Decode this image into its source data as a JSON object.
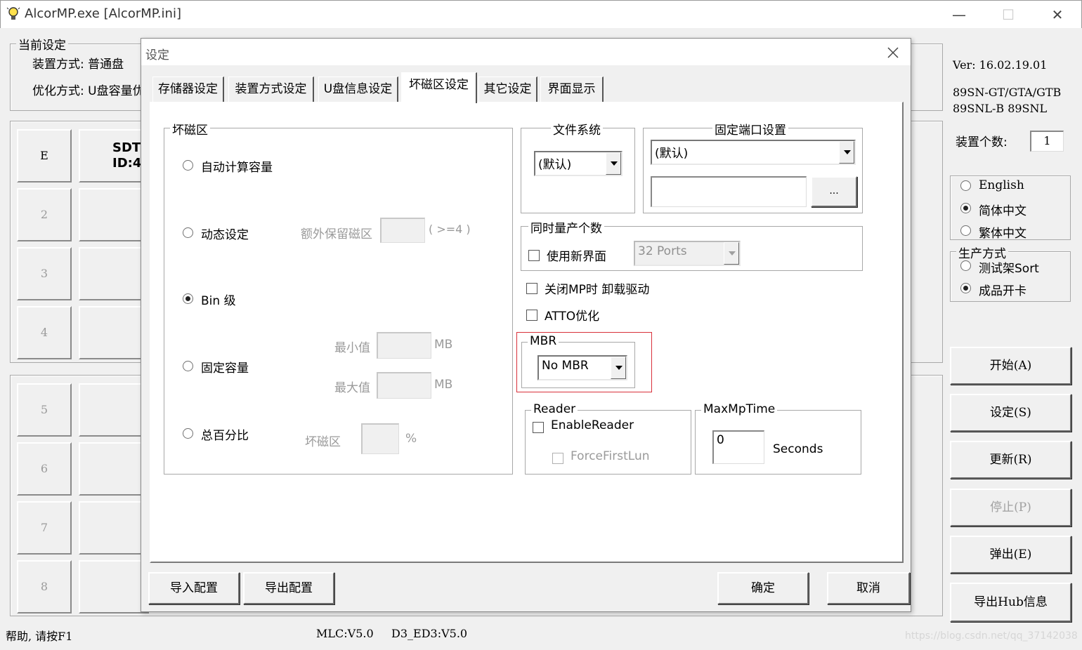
{
  "window": {
    "title": "AlcorMP.exe [AlcorMP.ini]",
    "controls": [
      "—",
      "☐",
      "✕"
    ]
  },
  "current_settings": {
    "group_label": "当前设定",
    "mount_mode": "装置方式: 普通盘",
    "optimize_mode": "优化方式: U盘容量优"
  },
  "slots": {
    "first_label": "E",
    "first_info_line1": "SDT",
    "first_info_line2": "ID:4",
    "numbers": [
      "2",
      "3",
      "4",
      "5",
      "6",
      "7",
      "8"
    ]
  },
  "right_panel": {
    "version": "Ver: 16.02.19.01",
    "models_line1": "89SN-GT/GTA/GTB",
    "models_line2": "89SNL-B 89SNL",
    "device_count_label": "装置个数:",
    "device_count_value": "1",
    "languages": [
      {
        "label": "English",
        "selected": false
      },
      {
        "label": "简体中文",
        "selected": true
      },
      {
        "label": "繁体中文",
        "selected": false
      }
    ],
    "production_mode": {
      "label": "生产方式",
      "options": [
        {
          "label": "测试架Sort",
          "selected": false
        },
        {
          "label": "成品开卡",
          "selected": true
        }
      ]
    },
    "buttons": {
      "start": "开始(A)",
      "settings": "设定(S)",
      "update": "更新(R)",
      "stop": "停止(P)",
      "eject": "弹出(E)",
      "export_hub": "导出Hub信息"
    }
  },
  "status_bar": {
    "help": "帮助, 请按F1",
    "mlc": "MLC:V5.0",
    "d3": "D3_ED3:V5.0",
    "watermark": "https://blog.csdn.net/qq_37142038"
  },
  "dialog": {
    "title": "设定",
    "tabs": [
      "存储器设定",
      "装置方式设定",
      "U盘信息设定",
      "坏磁区设定",
      "其它设定",
      "界面显示"
    ],
    "active_tab": "坏磁区设定",
    "bad_block": {
      "group_label": "坏磁区",
      "options": {
        "auto": "自动计算容量",
        "dynamic": "动态设定",
        "bin": "Bin 级",
        "fixed": "固定容量",
        "percent": "总百分比"
      },
      "selected": "Bin 级",
      "extra_reserve_label": "额外保留磁区",
      "extra_reserve_hint": "( >=4 )",
      "min_label": "最小值",
      "max_label": "最大值",
      "mb_unit": "MB",
      "badblock_label": "坏磁区",
      "percent_unit": "%"
    },
    "filesystem": {
      "label": "文件系统",
      "value": "(默认)"
    },
    "fixed_port": {
      "label": "固定端口设置",
      "value": "(默认)",
      "browse": "..."
    },
    "simultaneous": {
      "label": "同时量产个数",
      "use_new_ui": "使用新界面",
      "ports": "32 Ports"
    },
    "unload_driver": "关闭MP时 卸载驱动",
    "atto": "ATTO优化",
    "mbr": {
      "label": "MBR",
      "value": "No MBR"
    },
    "reader": {
      "label": "Reader",
      "enable": "EnableReader",
      "force_first_lun": "ForceFirstLun"
    },
    "max_mp_time": {
      "label": "MaxMpTime",
      "value": "0",
      "unit": "Seconds"
    },
    "buttons": {
      "import": "导入配置",
      "export": "导出配置",
      "ok": "确定",
      "cancel": "取消"
    },
    "highlight_color": "#d9303a"
  }
}
